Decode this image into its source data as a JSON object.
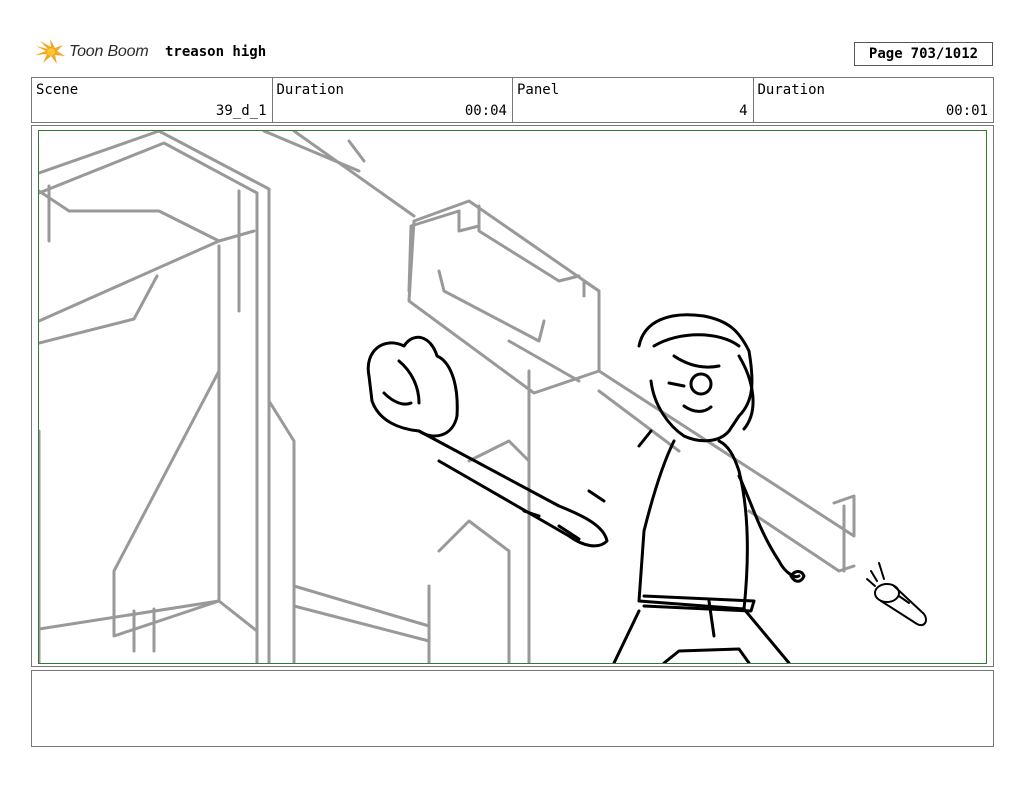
{
  "header": {
    "brand": "Toon Boom",
    "project_title": "treason high",
    "page_label": "Page",
    "page_value": "703/1012"
  },
  "info": [
    {
      "label": "Scene",
      "value": "39_d_1"
    },
    {
      "label": "Duration",
      "value": "00:04"
    },
    {
      "label": "Panel",
      "value": "4"
    },
    {
      "label": "Duration",
      "value": "00:01"
    }
  ],
  "notes": "",
  "colors": {
    "frame_green": "#2e7d32",
    "sketch_grey": "#999999",
    "ink": "#000000",
    "logo_orange": "#f5a623"
  }
}
